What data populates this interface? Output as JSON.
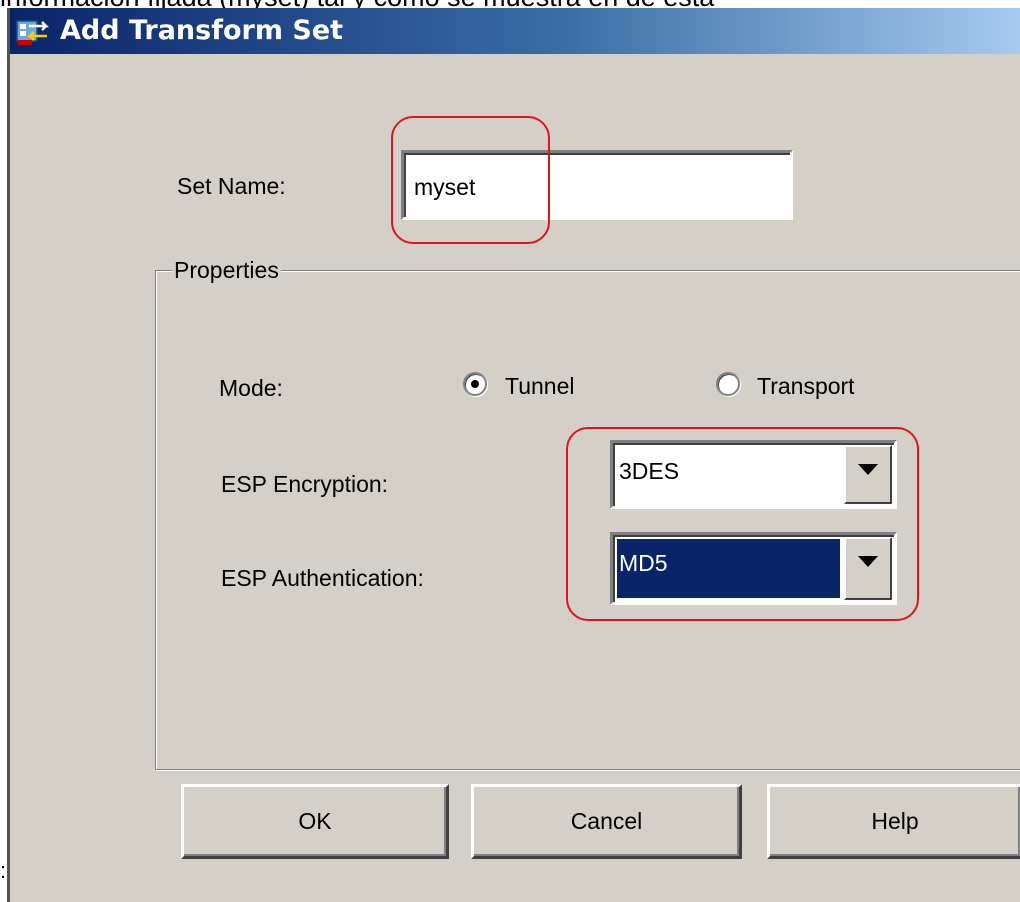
{
  "caption_text": "información fijada (myset) tal y como se muestra en de esta",
  "left_margin_char": ":",
  "dialog": {
    "title": "Add Transform Set",
    "icon": "transform-set-app-icon",
    "set_name_label": "Set Name:",
    "set_name_value": "myset",
    "properties_group": {
      "legend": "Properties",
      "mode_label": "Mode:",
      "mode_options": [
        {
          "label": "Tunnel",
          "checked": true
        },
        {
          "label": "Transport",
          "checked": false
        }
      ],
      "esp_encryption_label": "ESP Encryption:",
      "esp_encryption_value": "3DES",
      "esp_authentication_label": "ESP Authentication:",
      "esp_authentication_value": "MD5"
    },
    "buttons": {
      "ok": "OK",
      "cancel": "Cancel",
      "help": "Help"
    }
  },
  "colors": {
    "annotation_red": "#e0141e",
    "title_gradient_start": "#0a246a",
    "title_gradient_end": "#a6caf0",
    "selection_blue": "#0a246a",
    "dialog_gray": "#d4d0c8"
  }
}
